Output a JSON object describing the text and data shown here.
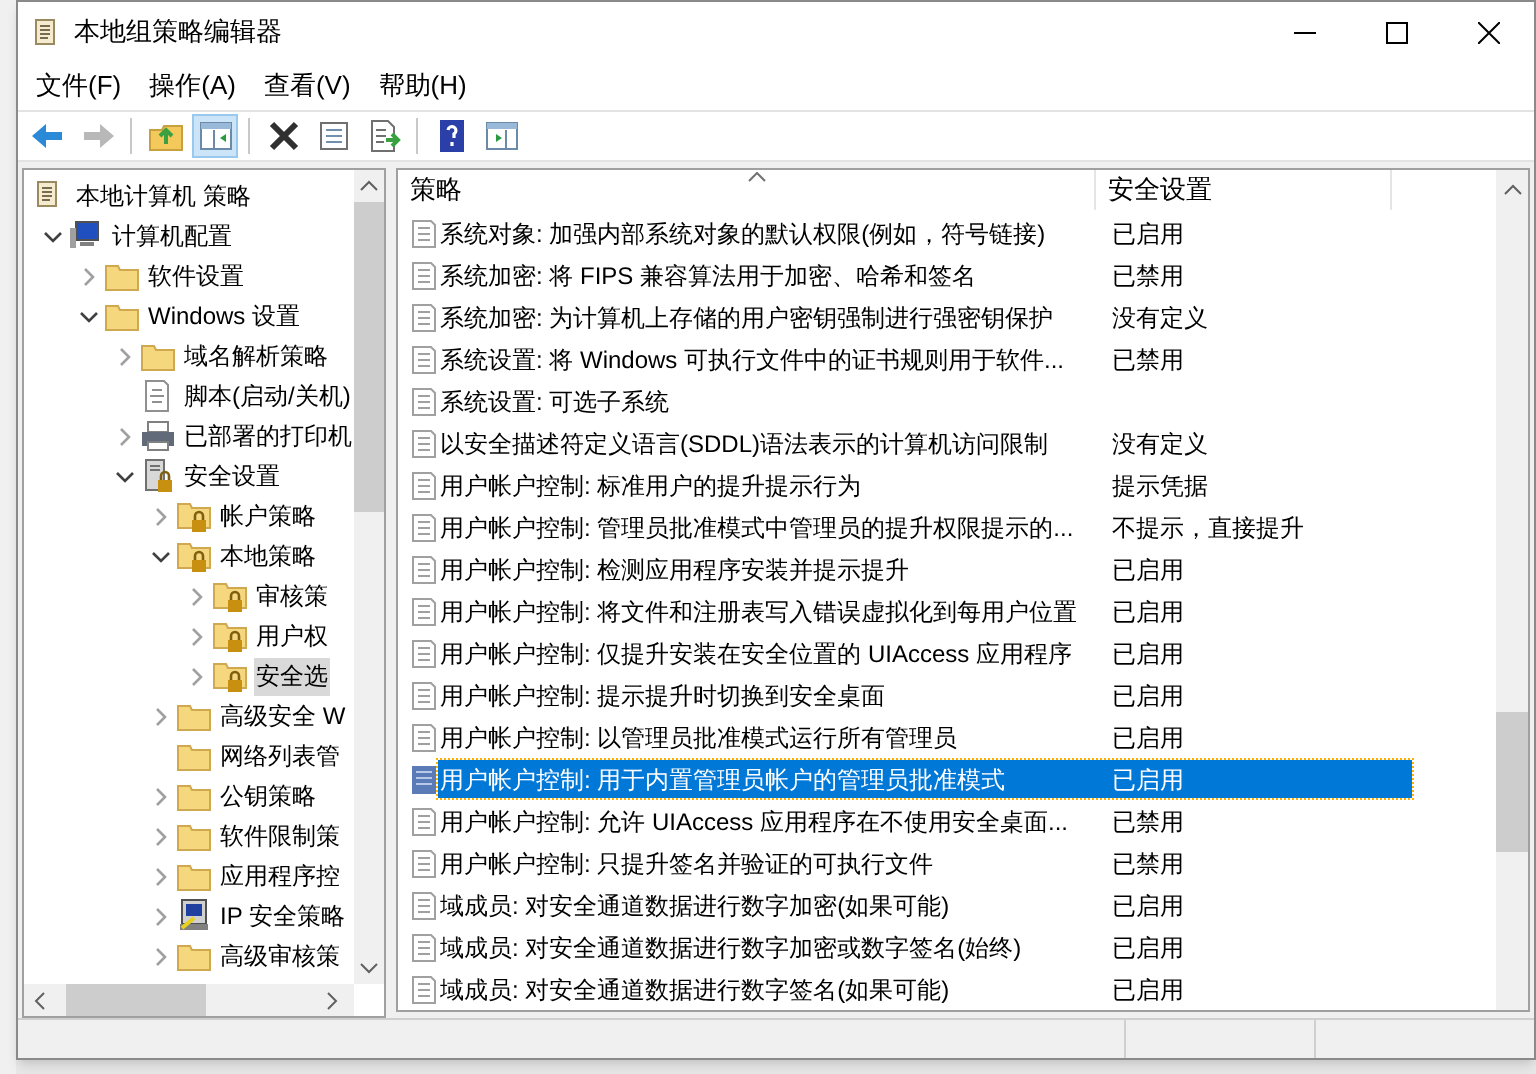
{
  "window": {
    "title": "本地组策略编辑器"
  },
  "menu": [
    "文件(F)",
    "操作(A)",
    "查看(V)",
    "帮助(H)"
  ],
  "toolbar": [
    {
      "kind": "button",
      "disabled": false,
      "pressed": false
    },
    {
      "kind": "button",
      "disabled": true,
      "pressed": false
    },
    {
      "kind": "separator"
    },
    {
      "kind": "button",
      "disabled": false,
      "pressed": false
    },
    {
      "kind": "button",
      "disabled": false,
      "pressed": true
    },
    {
      "kind": "separator"
    },
    {
      "kind": "button",
      "disabled": false,
      "pressed": false
    },
    {
      "kind": "button",
      "disabled": false,
      "pressed": false
    },
    {
      "kind": "button",
      "disabled": false,
      "pressed": false
    },
    {
      "kind": "separator"
    },
    {
      "kind": "button",
      "disabled": false,
      "pressed": false
    },
    {
      "kind": "button",
      "disabled": false,
      "pressed": false
    }
  ],
  "tree": [
    {
      "label": "本地计算机 策略",
      "kind": "scroll",
      "selected": false,
      "children": [
        {
          "label": "计算机配置",
          "kind": "computer",
          "expanded": true,
          "selected": false,
          "children": [
            {
              "label": "软件设置",
              "kind": "folder",
              "expanded": false,
              "selected": false
            },
            {
              "label": "Windows 设置",
              "kind": "folder",
              "expanded": true,
              "selected": false,
              "children": [
                {
                  "label": "域名解析策略",
                  "kind": "folder",
                  "expanded": false,
                  "selected": false
                },
                {
                  "label": "脚本(启动/关机)",
                  "kind": "script",
                  "selected": false
                },
                {
                  "label": "已部署的打印机",
                  "kind": "printer",
                  "expanded": false,
                  "selected": false
                },
                {
                  "label": "安全设置",
                  "kind": "server",
                  "expanded": true,
                  "selected": false,
                  "children": [
                    {
                      "label": "帐户策略",
                      "kind": "lockfolder",
                      "expanded": false,
                      "selected": false
                    },
                    {
                      "label": "本地策略",
                      "kind": "lockfolder",
                      "expanded": true,
                      "selected": false,
                      "children": [
                        {
                          "label": "审核策",
                          "kind": "lockfolder",
                          "expanded": false,
                          "selected": false
                        },
                        {
                          "label": "用户权",
                          "kind": "lockfolder",
                          "expanded": false,
                          "selected": false
                        },
                        {
                          "label": "安全选",
                          "kind": "lockfolder",
                          "expanded": false,
                          "selected": true
                        }
                      ]
                    },
                    {
                      "label": "高级安全 W",
                      "kind": "folder",
                      "expanded": false,
                      "selected": false
                    },
                    {
                      "label": "网络列表管",
                      "kind": "folder",
                      "selected": false
                    },
                    {
                      "label": "公钥策略",
                      "kind": "folder",
                      "expanded": false,
                      "selected": false
                    },
                    {
                      "label": "软件限制策",
                      "kind": "folder",
                      "expanded": false,
                      "selected": false
                    },
                    {
                      "label": "应用程序控",
                      "kind": "folder",
                      "expanded": false,
                      "selected": false
                    },
                    {
                      "label": "IP 安全策略",
                      "kind": "ipsec",
                      "expanded": false,
                      "selected": false
                    },
                    {
                      "label": "高级审核策",
                      "kind": "folder",
                      "expanded": false,
                      "selected": false
                    }
                  ]
                }
              ]
            }
          ]
        }
      ]
    }
  ],
  "table": {
    "columns": [
      "策略",
      "安全设置"
    ],
    "rows": [
      {
        "policy": "系统对象: 加强内部系统对象的默认权限(例如，符号链接)",
        "setting": "已启用",
        "selected": false
      },
      {
        "policy": "系统加密: 将 FIPS 兼容算法用于加密、哈希和签名",
        "setting": "已禁用",
        "selected": false
      },
      {
        "policy": "系统加密: 为计算机上存储的用户密钥强制进行强密钥保护",
        "setting": "没有定义",
        "selected": false
      },
      {
        "policy": "系统设置: 将 Windows 可执行文件中的证书规则用于软件...",
        "setting": "已禁用",
        "selected": false
      },
      {
        "policy": "系统设置: 可选子系统",
        "selected": false
      },
      {
        "policy": "以安全描述符定义语言(SDDL)语法表示的计算机访问限制",
        "setting": "没有定义",
        "selected": false
      },
      {
        "policy": "用户帐户控制: 标准用户的提升提示行为",
        "setting": "提示凭据",
        "selected": false
      },
      {
        "policy": "用户帐户控制: 管理员批准模式中管理员的提升权限提示的...",
        "setting": "不提示，直接提升",
        "selected": false
      },
      {
        "policy": "用户帐户控制: 检测应用程序安装并提示提升",
        "setting": "已启用",
        "selected": false
      },
      {
        "policy": "用户帐户控制: 将文件和注册表写入错误虚拟化到每用户位置",
        "setting": "已启用",
        "selected": false
      },
      {
        "policy": "用户帐户控制: 仅提升安装在安全位置的 UIAccess 应用程序",
        "setting": "已启用",
        "selected": false
      },
      {
        "policy": "用户帐户控制: 提示提升时切换到安全桌面",
        "setting": "已启用",
        "selected": false
      },
      {
        "policy": "用户帐户控制: 以管理员批准模式运行所有管理员",
        "setting": "已启用",
        "selected": false
      },
      {
        "policy": "用户帐户控制: 用于内置管理员帐户的管理员批准模式",
        "setting": "已启用",
        "selected": true
      },
      {
        "policy": "用户帐户控制: 允许 UIAccess 应用程序在不使用安全桌面...",
        "setting": "已禁用",
        "selected": false
      },
      {
        "policy": "用户帐户控制: 只提升签名并验证的可执行文件",
        "setting": "已禁用",
        "selected": false
      },
      {
        "policy": "域成员: 对安全通道数据进行数字加密(如果可能)",
        "setting": "已启用",
        "selected": false
      },
      {
        "policy": "域成员: 对安全通道数据进行数字加密或数字签名(始终)",
        "setting": "已启用",
        "selected": false
      },
      {
        "policy": "域成员: 对安全通道数据进行数字签名(如果可能)",
        "setting": "已启用",
        "selected": false
      }
    ]
  }
}
